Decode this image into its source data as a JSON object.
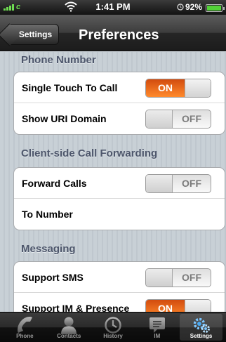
{
  "status_bar": {
    "carrier": "c",
    "time": "1:41 PM",
    "battery": "92%"
  },
  "nav": {
    "back_label": "Settings",
    "title": "Preferences"
  },
  "sections": [
    {
      "title": "Phone Number",
      "rows": [
        {
          "label": "Single Touch To Call",
          "control": "toggle",
          "state": "ON"
        },
        {
          "label": "Show URI Domain",
          "control": "toggle",
          "state": "OFF"
        }
      ]
    },
    {
      "title": "Client-side Call Forwarding",
      "rows": [
        {
          "label": "Forward Calls",
          "control": "toggle",
          "state": "OFF"
        },
        {
          "label": "To Number",
          "control": "text"
        }
      ]
    },
    {
      "title": "Messaging",
      "rows": [
        {
          "label": "Support SMS",
          "control": "toggle",
          "state": "OFF"
        },
        {
          "label": "Support IM & Presence",
          "control": "toggle",
          "state": "ON"
        }
      ]
    }
  ],
  "tabs": [
    {
      "label": "Phone",
      "icon": "phone-icon"
    },
    {
      "label": "Contacts",
      "icon": "contacts-icon"
    },
    {
      "label": "History",
      "icon": "clock-icon"
    },
    {
      "label": "IM",
      "icon": "chat-bubble-icon"
    },
    {
      "label": "Settings",
      "icon": "gears-icon",
      "selected": true
    }
  ],
  "colors": {
    "toggle_on": "#ff7a1a",
    "section_header": "#4d566b",
    "signal": "#6fdc52"
  }
}
